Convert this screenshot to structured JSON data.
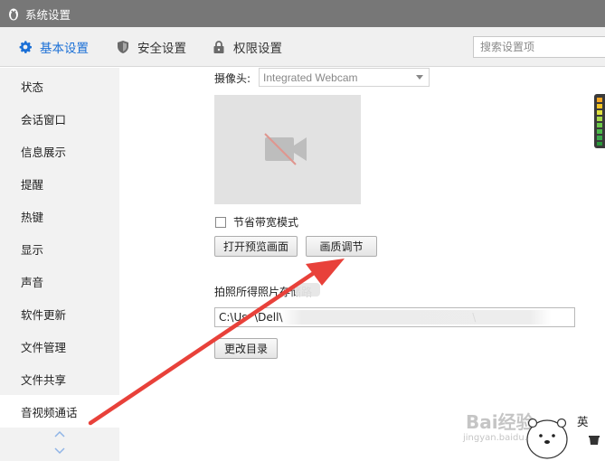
{
  "window": {
    "title": "系统设置"
  },
  "tabs": {
    "basic": "基本设置",
    "security": "安全设置",
    "permission": "权限设置"
  },
  "search": {
    "placeholder": "搜索设置项",
    "value": ""
  },
  "sidebar": {
    "items": [
      {
        "label": "状态"
      },
      {
        "label": "会话窗口"
      },
      {
        "label": "信息展示"
      },
      {
        "label": "提醒"
      },
      {
        "label": "热键"
      },
      {
        "label": "显示"
      },
      {
        "label": "声音"
      },
      {
        "label": "软件更新"
      },
      {
        "label": "文件管理"
      },
      {
        "label": "文件共享"
      },
      {
        "label": "音视频通话"
      }
    ],
    "selected": "音视频通话"
  },
  "camera": {
    "label": "摄像头:",
    "selected": "Integrated Webcam"
  },
  "bandwidth": {
    "label": "节省带宽模式",
    "checked": false
  },
  "buttons": {
    "preview": "打开预览画面",
    "quality": "画质调节",
    "change_dir": "更改目录"
  },
  "photo_save": {
    "label": "拍照所得照片存储路",
    "path": "C:\\Us  \\Dell\\                                                       \\"
  },
  "watermark": {
    "text": "Bai经验",
    "sub": "jingyan.baidu.com"
  },
  "ime": {
    "label": "英"
  },
  "colors": {
    "titlebar": "#777777",
    "accent": "#1a6fd6",
    "annotation_arrow": "#e8413a",
    "sidebar_bg": "#f2f2f2"
  },
  "icons": {
    "app": "penguin-icon",
    "basic_tab": "gear-icon",
    "security_tab": "shield-icon",
    "permission_tab": "lock-icon",
    "preview": "camera-off-icon"
  }
}
